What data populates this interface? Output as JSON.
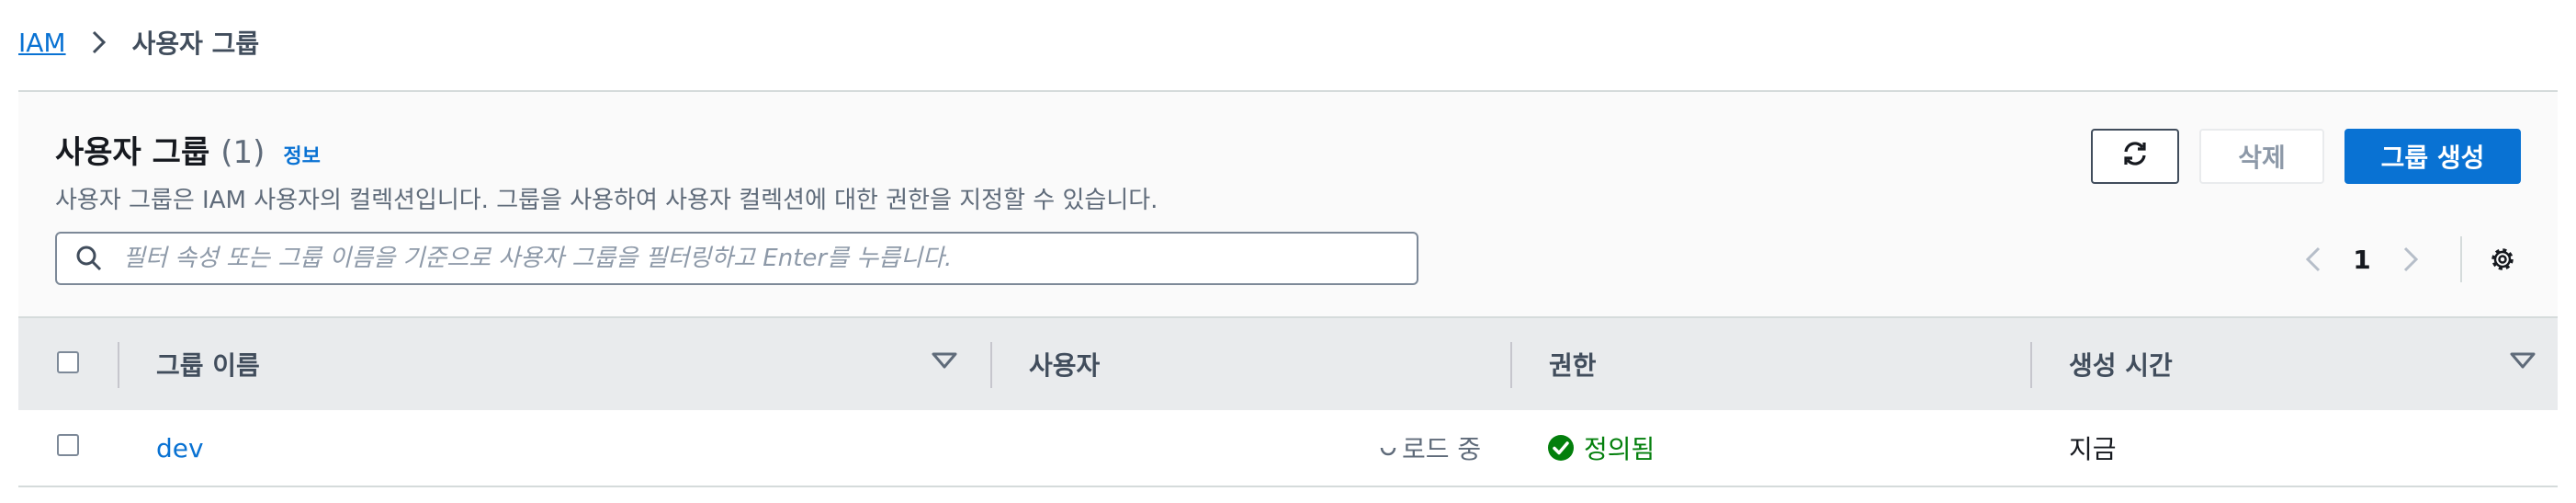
{
  "breadcrumb": {
    "root": "IAM",
    "current": "사용자 그룹"
  },
  "header": {
    "title": "사용자 그룹",
    "count": "(1)",
    "info": "정보",
    "description": "사용자 그룹은 IAM 사용자의 컬렉션입니다. 그룹을 사용하여 사용자 컬렉션에 대한 권한을 지정할 수 있습니다."
  },
  "actions": {
    "delete": "삭제",
    "create": "그룹 생성"
  },
  "filter": {
    "placeholder": "필터 속성 또는 그룹 이름을 기준으로 사용자 그룹을 필터링하고 Enter를 누릅니다.",
    "value": ""
  },
  "pagination": {
    "page": "1"
  },
  "table": {
    "columns": {
      "name": "그룹 이름",
      "users": "사용자",
      "permissions": "권한",
      "created": "생성 시간"
    },
    "rows": [
      {
        "name": "dev",
        "users": "로드 중",
        "permissions": "정의됨",
        "created": "지금"
      }
    ]
  },
  "icons": [
    "chevron-right-icon",
    "refresh-icon",
    "search-icon",
    "chevron-left-icon",
    "chevron-right-icon",
    "gear-icon",
    "sort-caret-icon",
    "loading-spinner-icon",
    "success-check-icon"
  ],
  "colors": {
    "primary": "#0972d3",
    "success": "#037f0c",
    "text": "#16191f",
    "muted": "#5f6b7a"
  }
}
